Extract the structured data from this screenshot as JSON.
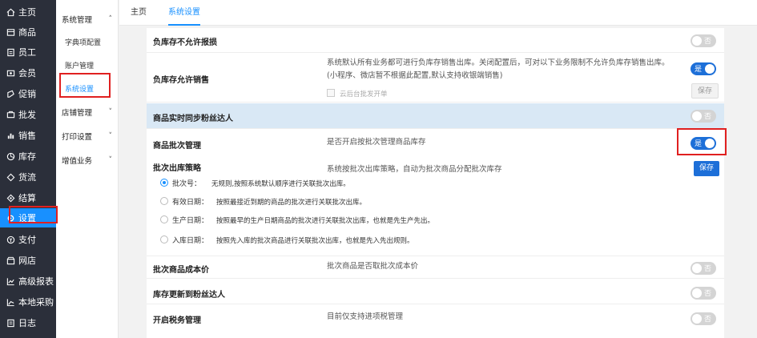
{
  "sidebar": {
    "items": [
      {
        "label": "主页",
        "icon": "home-icon"
      },
      {
        "label": "商品",
        "icon": "goods-icon"
      },
      {
        "label": "员工",
        "icon": "staff-icon"
      },
      {
        "label": "会员",
        "icon": "member-icon"
      },
      {
        "label": "促销",
        "icon": "promo-icon"
      },
      {
        "label": "批发",
        "icon": "wholesale-icon"
      },
      {
        "label": "销售",
        "icon": "sales-chart-icon"
      },
      {
        "label": "库存",
        "icon": "stock-icon"
      },
      {
        "label": "货流",
        "icon": "flow-icon"
      },
      {
        "label": "结算",
        "icon": "settle-icon"
      },
      {
        "label": "设置",
        "icon": "settings-icon"
      },
      {
        "label": "支付",
        "icon": "pay-icon"
      },
      {
        "label": "网店",
        "icon": "shop-icon"
      },
      {
        "label": "高级报表",
        "icon": "report-icon"
      },
      {
        "label": "本地采购",
        "icon": "purchase-icon"
      },
      {
        "label": "日志",
        "icon": "log-icon"
      }
    ]
  },
  "submenu": {
    "group_system": "系统管理",
    "item_dict": "字典项配置",
    "item_account": "账户管理",
    "item_settings": "系统设置",
    "group_store": "店铺管理",
    "group_print": "打印设置",
    "group_value": "增值业务"
  },
  "tabs": {
    "home": "主页",
    "settings": "系统设置"
  },
  "settings": {
    "neg_stock_disallow": {
      "label": "负库存不允许报损",
      "toggle": "否"
    },
    "neg_stock_allow": {
      "label": "负库存允许销售",
      "desc": "系统默认所有业务都可进行负库存销售出库。关闭配置后，可对以下业务限制不允许负库存销售出库。(小程序、微店暂不根据此配置,默认支持收银端销售)",
      "toggle": "是",
      "checkbox_label": "云后台批发开单",
      "save": "保存"
    },
    "realtime_sync": {
      "label": "商品实时同步粉丝达人",
      "toggle": "否"
    },
    "batch_mgmt": {
      "label": "商品批次管理",
      "desc": "是否开启按批次管理商品库存",
      "toggle": "是"
    },
    "batch_outbound": {
      "label": "批次出库策略",
      "desc": "系统按批次出库策略，自动为批次商品分配批次库存",
      "save": "保存",
      "options": [
        {
          "name": "批次号：",
          "desc": "无规则,按照系统默认顺序进行关联批次出库。"
        },
        {
          "name": "有效日期：",
          "desc": "按照最接近到期的商品的批次进行关联批次出库。"
        },
        {
          "name": "生产日期：",
          "desc": "按照最早的生产日期商品的批次进行关联批次出库，也就是先生产先出。"
        },
        {
          "name": "入库日期：",
          "desc": "按照先入库的批次商品进行关联批次出库，也就是先入先出规则。"
        }
      ]
    },
    "batch_cost": {
      "label": "批次商品成本价",
      "desc": "批次商品是否取批次成本价",
      "toggle": "否"
    },
    "stock_sync": {
      "label": "库存更新到粉丝达人",
      "toggle": "否"
    },
    "tax_mgmt": {
      "label": "开启税务管理",
      "desc": "目前仅支持进项税管理",
      "toggle": "否"
    }
  }
}
